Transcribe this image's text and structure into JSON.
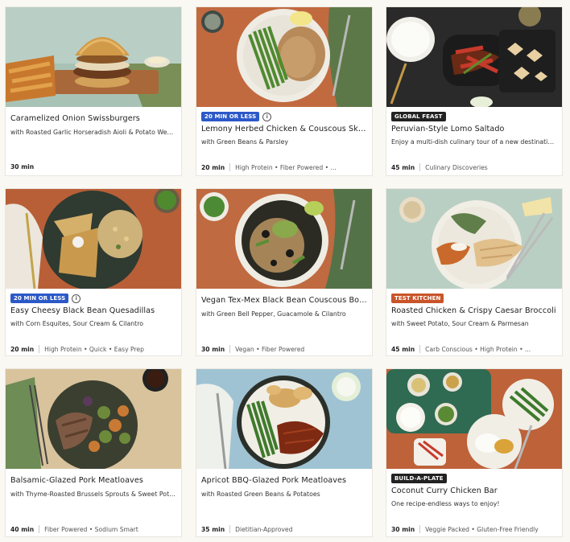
{
  "colors": {
    "badge_blue": "#2c59c8",
    "badge_black": "#222222",
    "badge_orange": "#c9542a",
    "page_bg": "#faf8f2"
  },
  "cards": [
    {
      "title": "Caramelized Onion Swissburgers",
      "subtitle": "with Roasted Garlic Horseradish Aioli & Potato Wedges",
      "time": "30 min",
      "tags": "",
      "badge": "",
      "info": false,
      "image": "burger-photo"
    },
    {
      "title": "Lemony Herbed Chicken & Couscous Skillet",
      "subtitle": "with Green Beans & Parsley",
      "time": "20 min",
      "tags": "High Protein • Fiber Powered • ...",
      "badge": "20 MIN OR LESS",
      "info": true,
      "image": "chicken-couscous-photo"
    },
    {
      "title": "Peruvian-Style Lomo Saltado",
      "subtitle": "Enjoy a multi-dish culinary tour of a new destination!",
      "time": "45 min",
      "tags": "Culinary Discoveries",
      "badge": "GLOBAL FEAST",
      "info": false,
      "image": "lomo-saltado-photo"
    },
    {
      "title": "Easy Cheesy Black Bean Quesadillas",
      "subtitle": "with Corn Esquites, Sour Cream & Cilantro",
      "time": "20 min",
      "tags": "High Protein • Quick • Easy Prep",
      "badge": "20 MIN OR LESS",
      "info": true,
      "image": "quesadilla-photo"
    },
    {
      "title": "Vegan Tex-Mex Black Bean Couscous Bowls",
      "subtitle": "with Green Bell Pepper, Guacamole & Cilantro",
      "time": "30 min",
      "tags": "Vegan • Fiber Powered",
      "badge": "",
      "info": false,
      "image": "couscous-bowl-photo"
    },
    {
      "title": "Roasted Chicken & Crispy Caesar Broccoli",
      "subtitle": "with Sweet Potato, Sour Cream & Parmesan",
      "time": "45 min",
      "tags": "Carb Conscious • High Protein • ...",
      "badge": "TEST KITCHEN",
      "info": false,
      "image": "roasted-chicken-photo"
    },
    {
      "title": "Balsamic-Glazed Pork Meatloaves",
      "subtitle": "with Thyme-Roasted Brussels Sprouts & Sweet Potatoes",
      "time": "40 min",
      "tags": "Fiber Powered • Sodium Smart",
      "badge": "",
      "info": false,
      "image": "balsamic-meatloaf-photo"
    },
    {
      "title": "Apricot BBQ-Glazed Pork Meatloaves",
      "subtitle": "with Roasted Green Beans & Potatoes",
      "time": "35 min",
      "tags": "Dietitian-Approved",
      "badge": "",
      "info": false,
      "image": "bbq-meatloaf-photo"
    },
    {
      "title": "Coconut Curry Chicken Bar",
      "subtitle": "One recipe-endless ways to enjoy!",
      "time": "30 min",
      "tags": "Veggie Packed • Gluten-Free Friendly",
      "badge": "BUILD-A-PLATE",
      "info": false,
      "image": "curry-bar-photo"
    }
  ]
}
